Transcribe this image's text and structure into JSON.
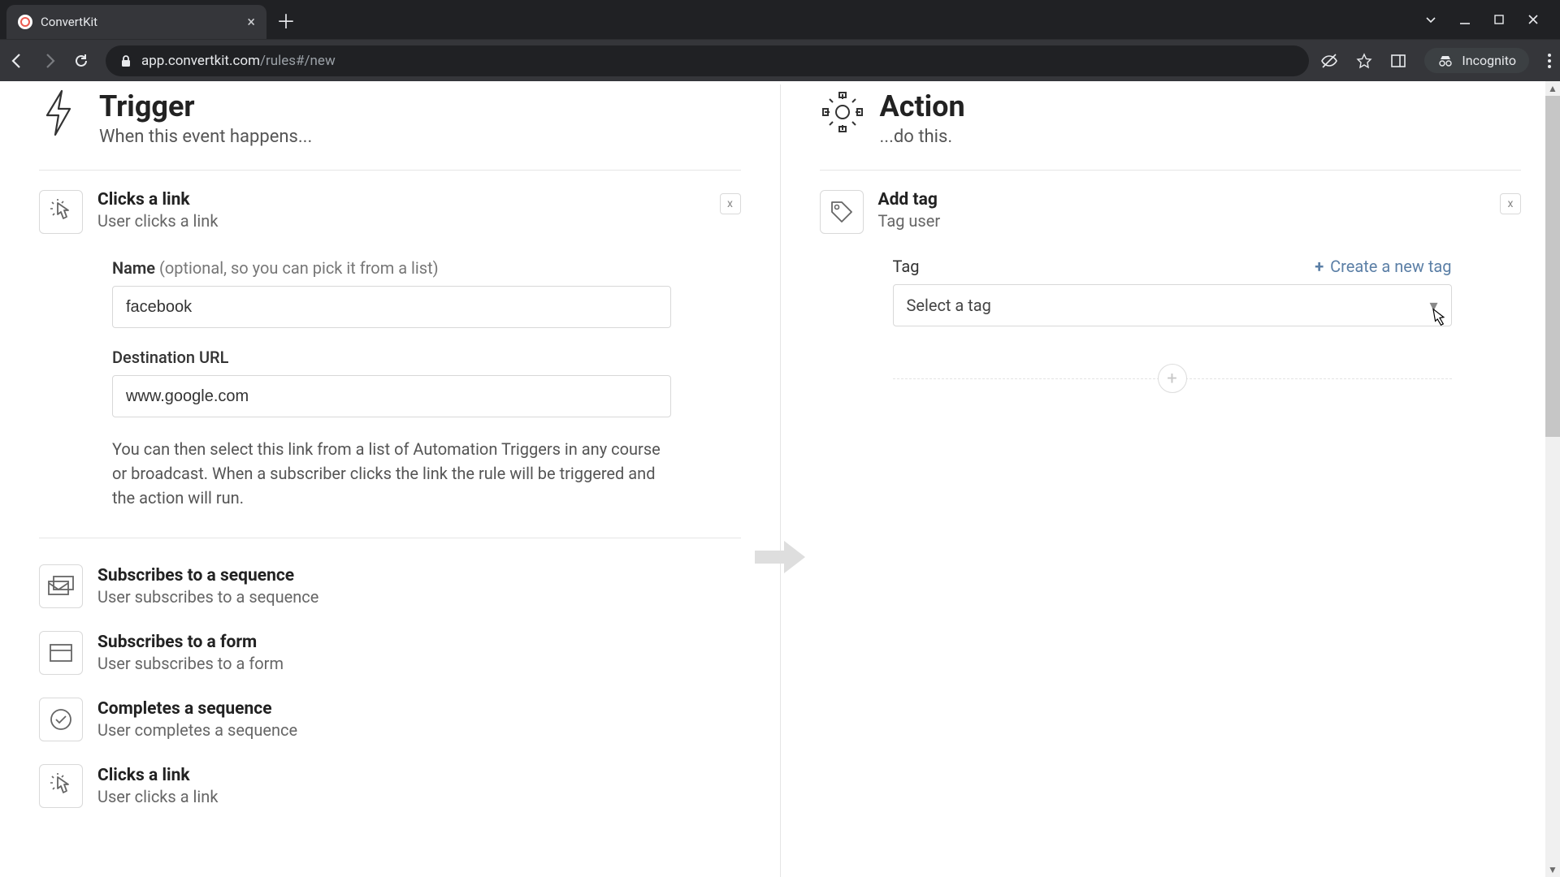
{
  "browser": {
    "tab_title": "ConvertKit",
    "url_secure_host": "app.convertkit.com",
    "url_path": "/rules#/new",
    "incognito_label": "Incognito"
  },
  "trigger": {
    "heading": "Trigger",
    "subheading": "When this event happens...",
    "selected": {
      "title": "Clicks a link",
      "subtitle": "User clicks a link",
      "close": "x"
    },
    "form": {
      "name_label": "Name",
      "name_hint": "(optional, so you can pick it from a list)",
      "name_value": "facebook",
      "url_label": "Destination URL",
      "url_value": "www.google.com",
      "help": "You can then select this link from a list of Automation Triggers in any course or broadcast. When a subscriber clicks the link the rule will be triggered and the action will run."
    },
    "options": [
      {
        "title": "Subscribes to a sequence",
        "subtitle": "User subscribes to a sequence"
      },
      {
        "title": "Subscribes to a form",
        "subtitle": "User subscribes to a form"
      },
      {
        "title": "Completes a sequence",
        "subtitle": "User completes a sequence"
      },
      {
        "title": "Clicks a link",
        "subtitle": "User clicks a link"
      }
    ]
  },
  "action": {
    "heading": "Action",
    "subheading": "...do this.",
    "selected": {
      "title": "Add tag",
      "subtitle": "Tag user",
      "close": "x"
    },
    "form": {
      "tag_label": "Tag",
      "create_tag": "Create a new tag",
      "select_placeholder": "Select a tag"
    }
  }
}
